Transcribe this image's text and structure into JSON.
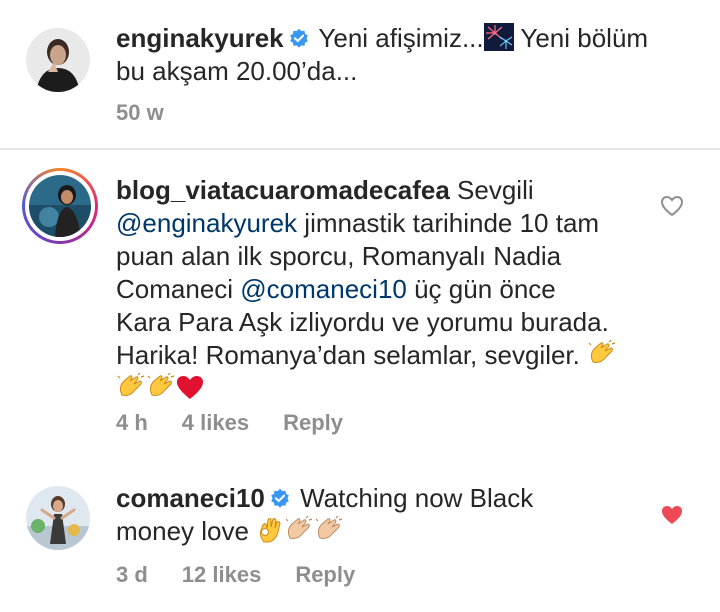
{
  "post": {
    "username": "enginakyurek",
    "caption_1": "Yeni afişimiz...",
    "caption_2": "Yeni bölüm",
    "caption_3": "bu akşam 20.00’da...",
    "age": "50 w",
    "icons": {
      "verified": "verified-badge-icon",
      "firework": "firework-emoji"
    }
  },
  "comments": [
    {
      "username": "blog_viatacuaromadecafea",
      "lines": {
        "l1": "Sevgili",
        "mention1": "@enginakyurek",
        "l2": " jimnastik tarihinde 10 tam",
        "l3": "puan alan ilk sporcu, Romanyalı Nadia",
        "l4a": "Comaneci ",
        "mention2": "@comaneci10",
        "l4b": " üç gün önce",
        "l5": "Kara Para Aşk izliyordu  ve yorumu burada.",
        "l6": "Harika! Romanya’dan selamlar, sevgiler. "
      },
      "age": "4 h",
      "likes": "4 likes",
      "reply": "Reply",
      "liked": false
    },
    {
      "username": "comaneci10",
      "lines": {
        "l1": "Watching now Black",
        "l2": "money love "
      },
      "age": "3 d",
      "likes": "12 likes",
      "reply": "Reply",
      "liked": true
    }
  ],
  "colors": {
    "verified": "#3897f0",
    "heart_liked": "#ed4956",
    "heart_empty": "#8e8e8e",
    "meta": "#8e8e8e",
    "mention": "#00376b"
  }
}
